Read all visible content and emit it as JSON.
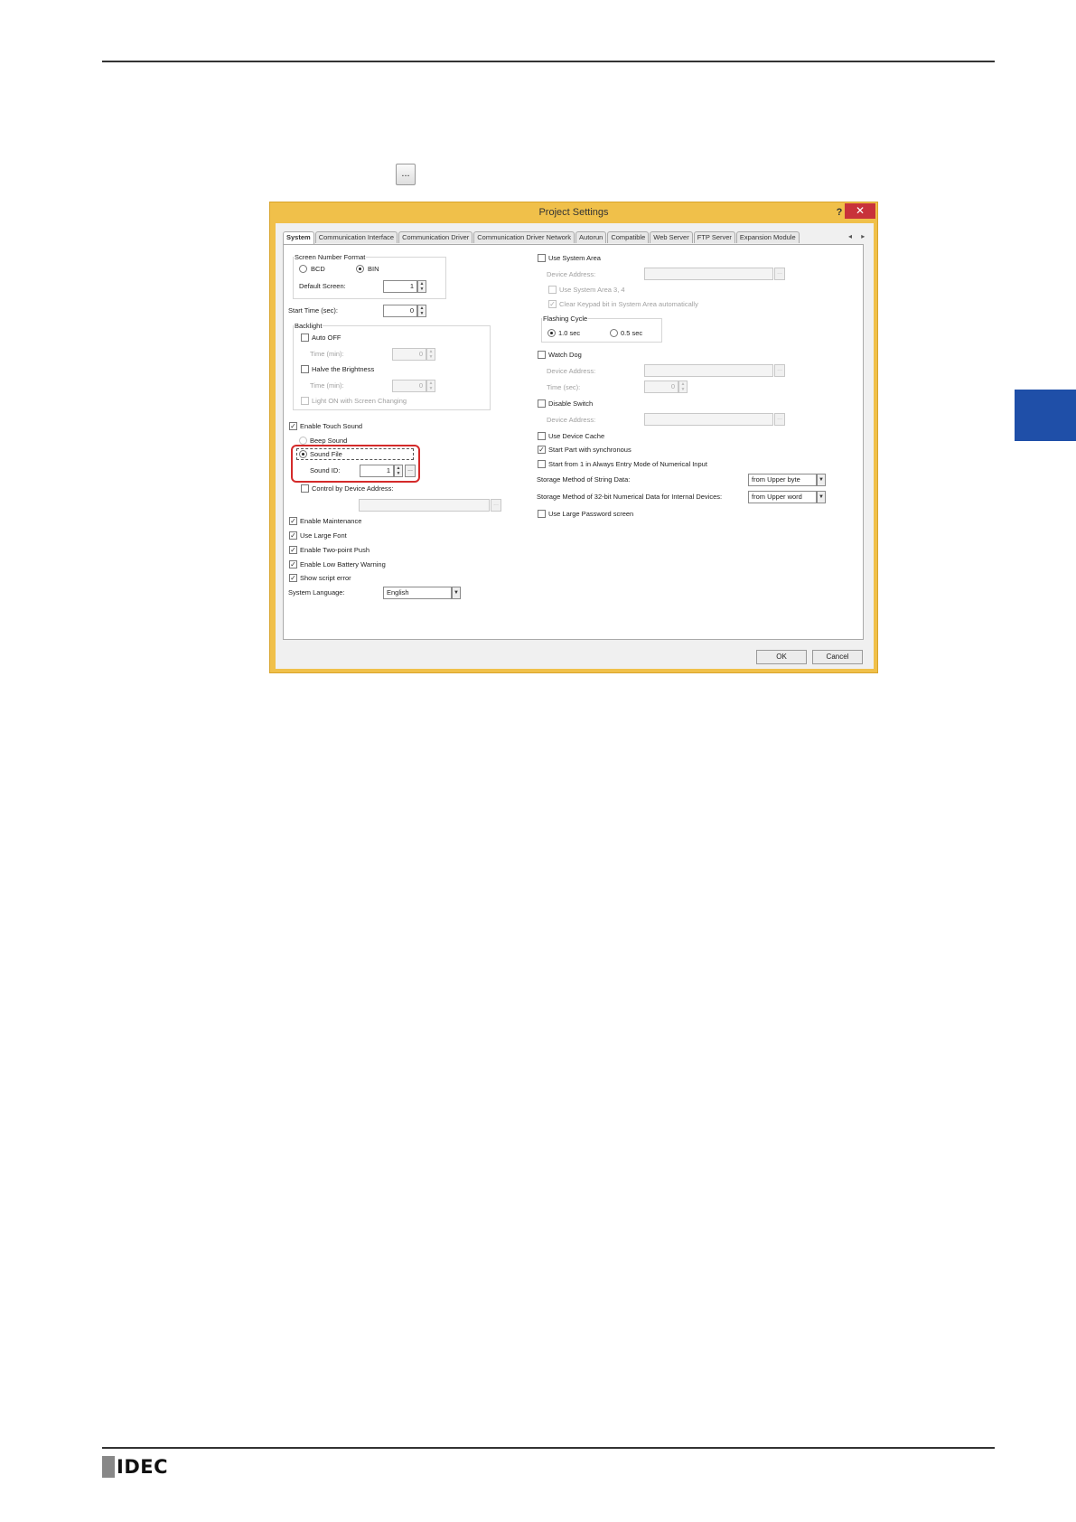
{
  "inline_button_label": "...",
  "footer_logo": "IDEC",
  "dialog": {
    "title": "Project Settings",
    "help": "?",
    "close": "✕",
    "tabs": [
      "System",
      "Communication Interface",
      "Communication Driver",
      "Communication Driver Network",
      "Autorun",
      "Compatible",
      "Web Server",
      "FTP Server",
      "Expansion Module"
    ],
    "tab_arrows": "◂ ▸",
    "left": {
      "screen_number_format": "Screen Number Format",
      "bcd": "BCD",
      "bin": "BIN",
      "default_screen": "Default Screen:",
      "default_screen_value": "1",
      "start_time": "Start Time (sec):",
      "start_time_value": "0",
      "backlight": "Backlight",
      "auto_off": "Auto OFF",
      "time_min_1": "Time (min):",
      "time_min_1_value": "0",
      "halve_brightness": "Halve the Brightness",
      "time_min_2": "Time (min):",
      "time_min_2_value": "0",
      "light_on": "Light ON with Screen Changing",
      "enable_touch_sound": "Enable Touch Sound",
      "beep_sound": "Beep Sound",
      "sound_file": "Sound File",
      "sound_id": "Sound ID:",
      "sound_id_value": "1",
      "control_by_device": "Control by Device Address:",
      "enable_maintenance": "Enable Maintenance",
      "use_large_font": "Use Large Font",
      "enable_two_point": "Enable Two-point Push",
      "enable_low_battery": "Enable Low Battery Warning",
      "show_script_error": "Show script error",
      "system_language": "System Language:",
      "system_language_value": "English"
    },
    "right": {
      "use_system_area": "Use System Area",
      "device_address_1": "Device Address:",
      "use_system_area_34": "Use System Area 3, 4",
      "clear_keypad": "Clear Keypad bit in System Area automatically",
      "flashing_cycle": "Flashing Cycle",
      "sec_10": "1.0 sec",
      "sec_05": "0.5 sec",
      "watch_dog": "Watch Dog",
      "device_address_2": "Device Address:",
      "time_sec": "Time (sec):",
      "time_sec_value": "0",
      "disable_switch": "Disable Switch",
      "device_address_3": "Device Address:",
      "use_device_cache": "Use Device Cache",
      "start_part_sync": "Start Part with synchronous",
      "start_from_1": "Start from 1 in Always Entry Mode of Numerical Input",
      "storage_string": "Storage Method of String Data:",
      "storage_string_value": "from Upper byte",
      "storage_32bit": "Storage Method of 32-bit Numerical Data for Internal Devices:",
      "storage_32bit_value": "from Upper word",
      "use_large_password": "Use Large Password screen"
    },
    "ok": "OK",
    "cancel": "Cancel"
  }
}
